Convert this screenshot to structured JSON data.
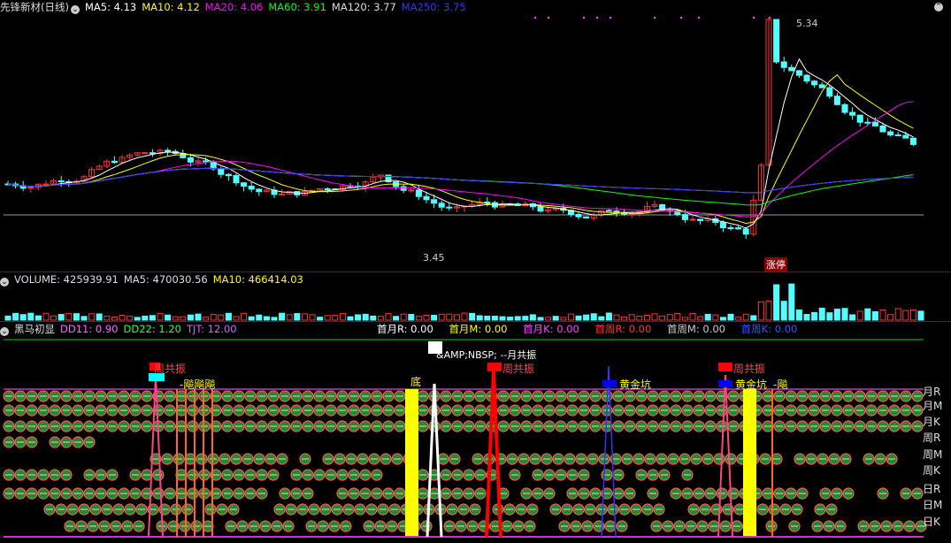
{
  "colors": {
    "ma5": "#ffffff",
    "ma10": "#ffff00",
    "ma20": "#ff00ff",
    "ma60": "#00ff00",
    "ma120": "#dddddd",
    "ma250": "#3333ff",
    "up": "#ff3333",
    "down": "#55ffff",
    "divider": "#a00000"
  },
  "price": {
    "title": "先锋新材(日线)",
    "ma5": "MA5: 4.13",
    "ma10": "MA10: 4.12",
    "ma20": "MA20: 4.06",
    "ma60": "MA60: 3.91",
    "ma120": "MA120: 3.77",
    "ma250": "MA250: 3.75",
    "high_label": "5.34",
    "low_label": "3.45",
    "limit_up": "涨停"
  },
  "volume": {
    "vol": "VOLUME: 425939.91",
    "ma5": "MA5: 470030.56",
    "ma10": "MA10: 466414.03"
  },
  "indicator": {
    "name": "黑马初显",
    "dd11": "DD11: 0.90",
    "dd22": "DD22: 1.20",
    "tjt": "TJT: 12.00",
    "stats": [
      {
        "label": "首月R: 0.00",
        "color": "#ffffff"
      },
      {
        "label": "首月M: 0.00",
        "color": "#ffff00"
      },
      {
        "label": "首月K: 0.00",
        "color": "#ff44ff"
      },
      {
        "label": "首周R: 0.00",
        "color": "#ff3333"
      },
      {
        "label": "首周M: 0.00",
        "color": "#cccccc"
      },
      {
        "label": "首周K: 0.00",
        "color": "#3355ff"
      }
    ],
    "row_labels": [
      "月R",
      "月M",
      "月K",
      "周R",
      "周M",
      "周K",
      "日R",
      "日M",
      "日K"
    ],
    "flags": {
      "zhou1": "周共振",
      "zhou2": "周共振",
      "zhou3": "周共振",
      "sig1": "-飚飚飚",
      "di": "底",
      "yue": "&AMP;NBSP; --月共振",
      "hj1": "黄金坑",
      "hj2": "黄金坑",
      "sig2": "-飚"
    }
  }
}
